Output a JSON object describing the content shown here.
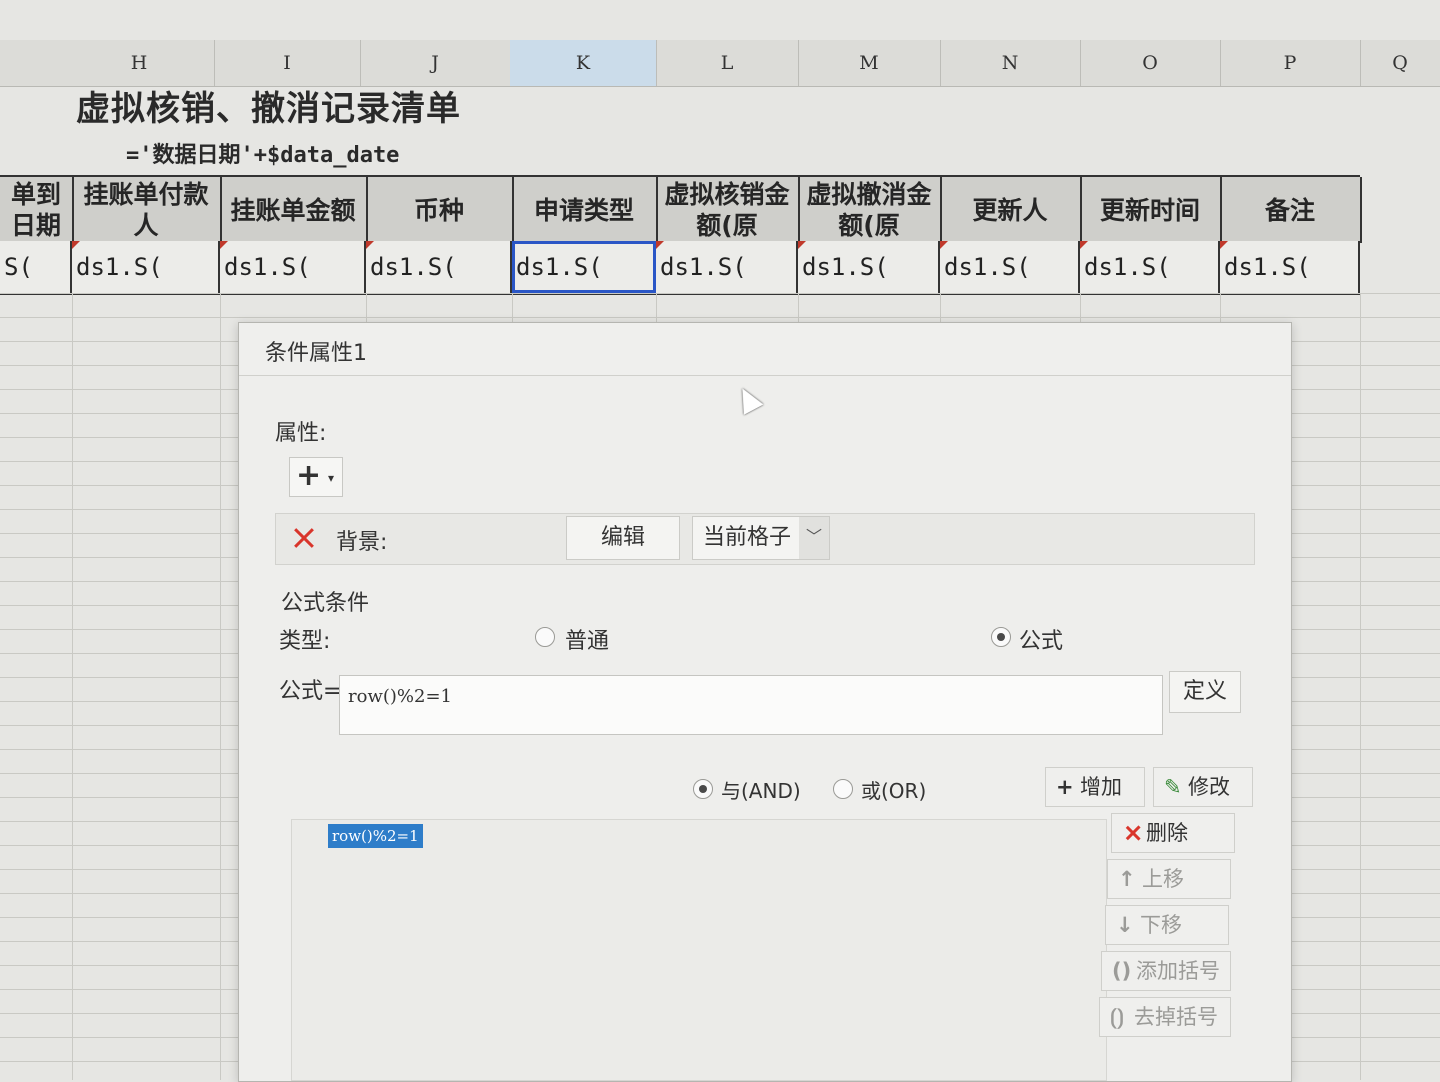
{
  "spreadsheet": {
    "columns": [
      "H",
      "I",
      "J",
      "K",
      "L",
      "M",
      "N",
      "O",
      "P",
      "Q"
    ],
    "active_column": "K",
    "title": "虚拟核销、撤消记录清单",
    "subtitle": "='数据日期'+$data_date",
    "headers": [
      "单到日期",
      "挂账单付款人",
      "挂账单金额",
      "币种",
      "申请类型",
      "虚拟核销金额(原",
      "虚拟撤消金额(原",
      "更新人",
      "更新时间",
      "备注"
    ],
    "cells": [
      "S(",
      "ds1.S(",
      "ds1.S(",
      "ds1.S(",
      "ds1.S(",
      "ds1.S(",
      "ds1.S(",
      "ds1.S(",
      "ds1.S(",
      "ds1.S("
    ]
  },
  "dialog": {
    "title": "条件属性1",
    "attributes_label": "属性:",
    "add_button": "+",
    "background_label": "背景:",
    "edit_button": "编辑",
    "scope_value": "当前格子",
    "formula_condition_label": "公式条件",
    "type_label": "类型:",
    "type_options": [
      "普通",
      "公式"
    ],
    "type_selected": "公式",
    "formula_label": "公式=",
    "formula_value": "row()%2=1",
    "define_button": "定义",
    "logic_options": [
      "与(AND)",
      "或(OR)"
    ],
    "logic_selected": "与(AND)",
    "add_condition_button": "增加",
    "modify_button": "修改",
    "delete_button": "删除",
    "move_up_button": "上移",
    "move_down_button": "下移",
    "add_parens_button": "添加括号",
    "remove_parens_button": "去掉括号",
    "conditions": [
      "row()%2=1"
    ]
  },
  "colors": {
    "accent": "#2a56c6",
    "delete_red": "#d9352b",
    "selection_blue": "#2e7dc9"
  }
}
